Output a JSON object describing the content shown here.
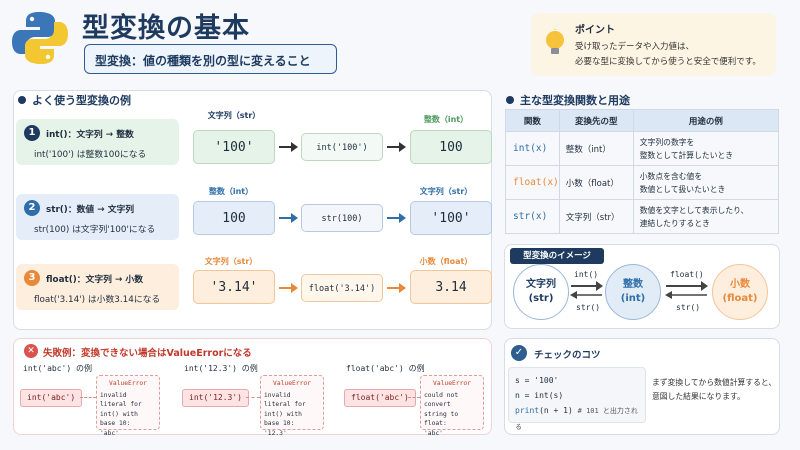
{
  "header": {
    "title": "型変換の基本",
    "subtitle": "型変換：値の種類を別の型に変えること",
    "tip_title": "ポイント",
    "tip_line1": "受け取ったデータや入力値は、",
    "tip_line2": "必要な型に変換してから使うと安全で便利です。"
  },
  "examples": {
    "section_title": "よく使う型変換の例",
    "items": [
      {
        "num": "1",
        "line1": "int()：文字列 → 整数",
        "line2": "int('100') は整数100になる",
        "from_label": "文字列（str）",
        "from_value": "'100'",
        "func": "int('100')",
        "to_label": "整数（int）",
        "to_value": "100"
      },
      {
        "num": "2",
        "line1": "str()：数値 → 文字列",
        "line2": "str(100) は文字列'100'になる",
        "from_label": "整数（int）",
        "from_value": "100",
        "func": "str(100)",
        "to_label": "文字列（str）",
        "to_value": "'100'"
      },
      {
        "num": "3",
        "line1": "float()：文字列 → 小数",
        "line2": "float('3.14') は小数3.14になる",
        "from_label": "文字列（str）",
        "from_value": "'3.14'",
        "func": "float('3.14')",
        "to_label": "小数（float）",
        "to_value": "3.14"
      }
    ]
  },
  "functions": {
    "section_title": "主な型変換関数と用途",
    "headers": [
      "関数",
      "変換先の型",
      "用途の例"
    ],
    "rows": [
      {
        "func": "int(x)",
        "type": "整数（int）",
        "use1": "文字列の数字を",
        "use2": "整数として計算したいとき"
      },
      {
        "func": "float(x)",
        "type": "小数（float）",
        "use1": "小数点を含む値を",
        "use2": "数値として扱いたいとき"
      },
      {
        "func": "str(x)",
        "type": "文字列（str）",
        "use1": "数値を文字として表示したり、",
        "use2": "連結したりするとき"
      }
    ]
  },
  "image": {
    "title": "型変換のイメージ",
    "str_label": "文字列",
    "str_type": "(str)",
    "int_label": "整数",
    "int_type": "(int)",
    "float_label": "小数",
    "float_type": "(float)",
    "a1": "int()",
    "a2": "str()",
    "a3": "float()",
    "a4": "str()"
  },
  "failure": {
    "title": "失敗例：変換できない場合はValueErrorになる",
    "cases": [
      {
        "head": "int('abc') の例",
        "input": "int('abc')",
        "err_title": "ValueError",
        "msg": [
          "invalid literal for",
          "int() with base 10:",
          "'abc'"
        ]
      },
      {
        "head": "int('12.3') の例",
        "input": "int('12.3')",
        "err_title": "ValueError",
        "msg": [
          "invalid literal for",
          "int() with base 10:",
          "'12.3'"
        ]
      },
      {
        "head": "float('abc') の例",
        "input": "float('abc')",
        "err_title": "ValueError",
        "msg": [
          "could not convert",
          "string to float:",
          "'abc'"
        ]
      }
    ]
  },
  "check": {
    "title": "チェックのコツ",
    "code1": "s = '100'",
    "code2": "n = int(s)",
    "code3_kw": "print",
    "code3_rest": "(n + 1)",
    "code3_comment": "# 101 と出力される",
    "text1": "まず変換してから数値計算すると、",
    "text2": "意図した結果になります。"
  },
  "colors": {
    "navy": "#1e3a5f",
    "green": "#4e9a5f",
    "blue": "#2f6ea8",
    "orange": "#e8893a",
    "red": "#c0392b"
  }
}
